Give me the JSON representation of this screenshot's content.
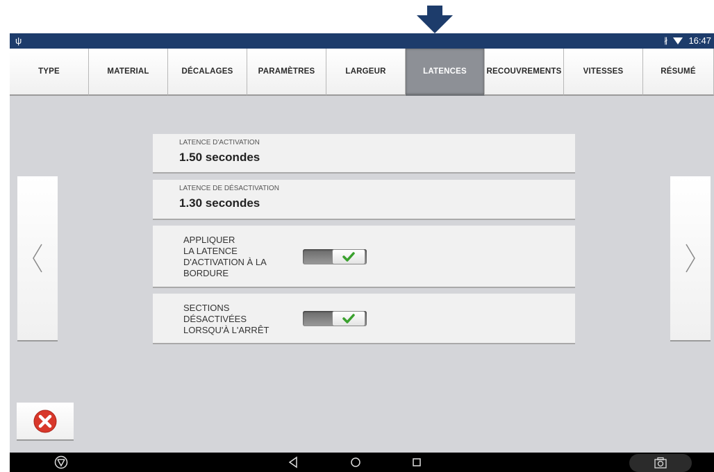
{
  "status_bar": {
    "usb_icon": "usb-icon",
    "bluetooth_icon": "bluetooth-icon",
    "wifi_icon": "wifi-icon",
    "time": "16:47"
  },
  "tabs": [
    {
      "label": "TYPE",
      "active": false
    },
    {
      "label": "MATERIAL",
      "active": false
    },
    {
      "label": "DÉCALAGES",
      "active": false
    },
    {
      "label": "PARAMÈTRES",
      "active": false
    },
    {
      "label": "LARGEUR",
      "active": false
    },
    {
      "label": "LATENCES",
      "active": true
    },
    {
      "label": "RECOUVREMENTS",
      "active": false
    },
    {
      "label": "VITESSES",
      "active": false
    },
    {
      "label": "RÉSUMÉ",
      "active": false
    }
  ],
  "fields": {
    "activation_latency": {
      "label": "LATENCE D'ACTIVATION",
      "value": "1.50  secondes"
    },
    "deactivation_latency": {
      "label": "LATENCE DE DÉSACTIVATION",
      "value": "1.30  secondes"
    }
  },
  "toggles": {
    "apply_border": {
      "lines": [
        "APPLIQUER",
        "LA LATENCE",
        "D'ACTIVATION À LA",
        "BORDURE"
      ],
      "checked": true
    },
    "sections_off_stop": {
      "lines": [
        "SECTIONS",
        "DÉSACTIVÉES",
        "LORSQU'À L'ARRÊT"
      ],
      "checked": true
    }
  },
  "navigation": {
    "prev_icon": "chevron-left-icon",
    "next_icon": "chevron-right-icon",
    "cancel_icon": "cancel-x-icon"
  },
  "colors": {
    "status_bar": "#1d3c6b",
    "annotation_arrow": "#1d3c6b",
    "active_tab": "#8d9096",
    "check_green": "#3aa12e",
    "cancel_red": "#d8382b"
  }
}
